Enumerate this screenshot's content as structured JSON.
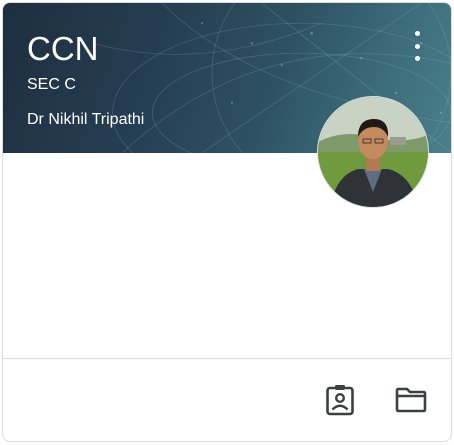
{
  "card": {
    "title": "CCN",
    "section": "SEC C",
    "teacher": "Dr Nikhil Tripathi"
  },
  "icons": {
    "more": "more-vert-icon",
    "assignment": "assignment-ind-icon",
    "folder": "folder-icon"
  },
  "colors": {
    "banner": "#263e52",
    "text_on_banner": "#ffffff",
    "icon": "#3c4043",
    "divider": "#dadce0"
  }
}
